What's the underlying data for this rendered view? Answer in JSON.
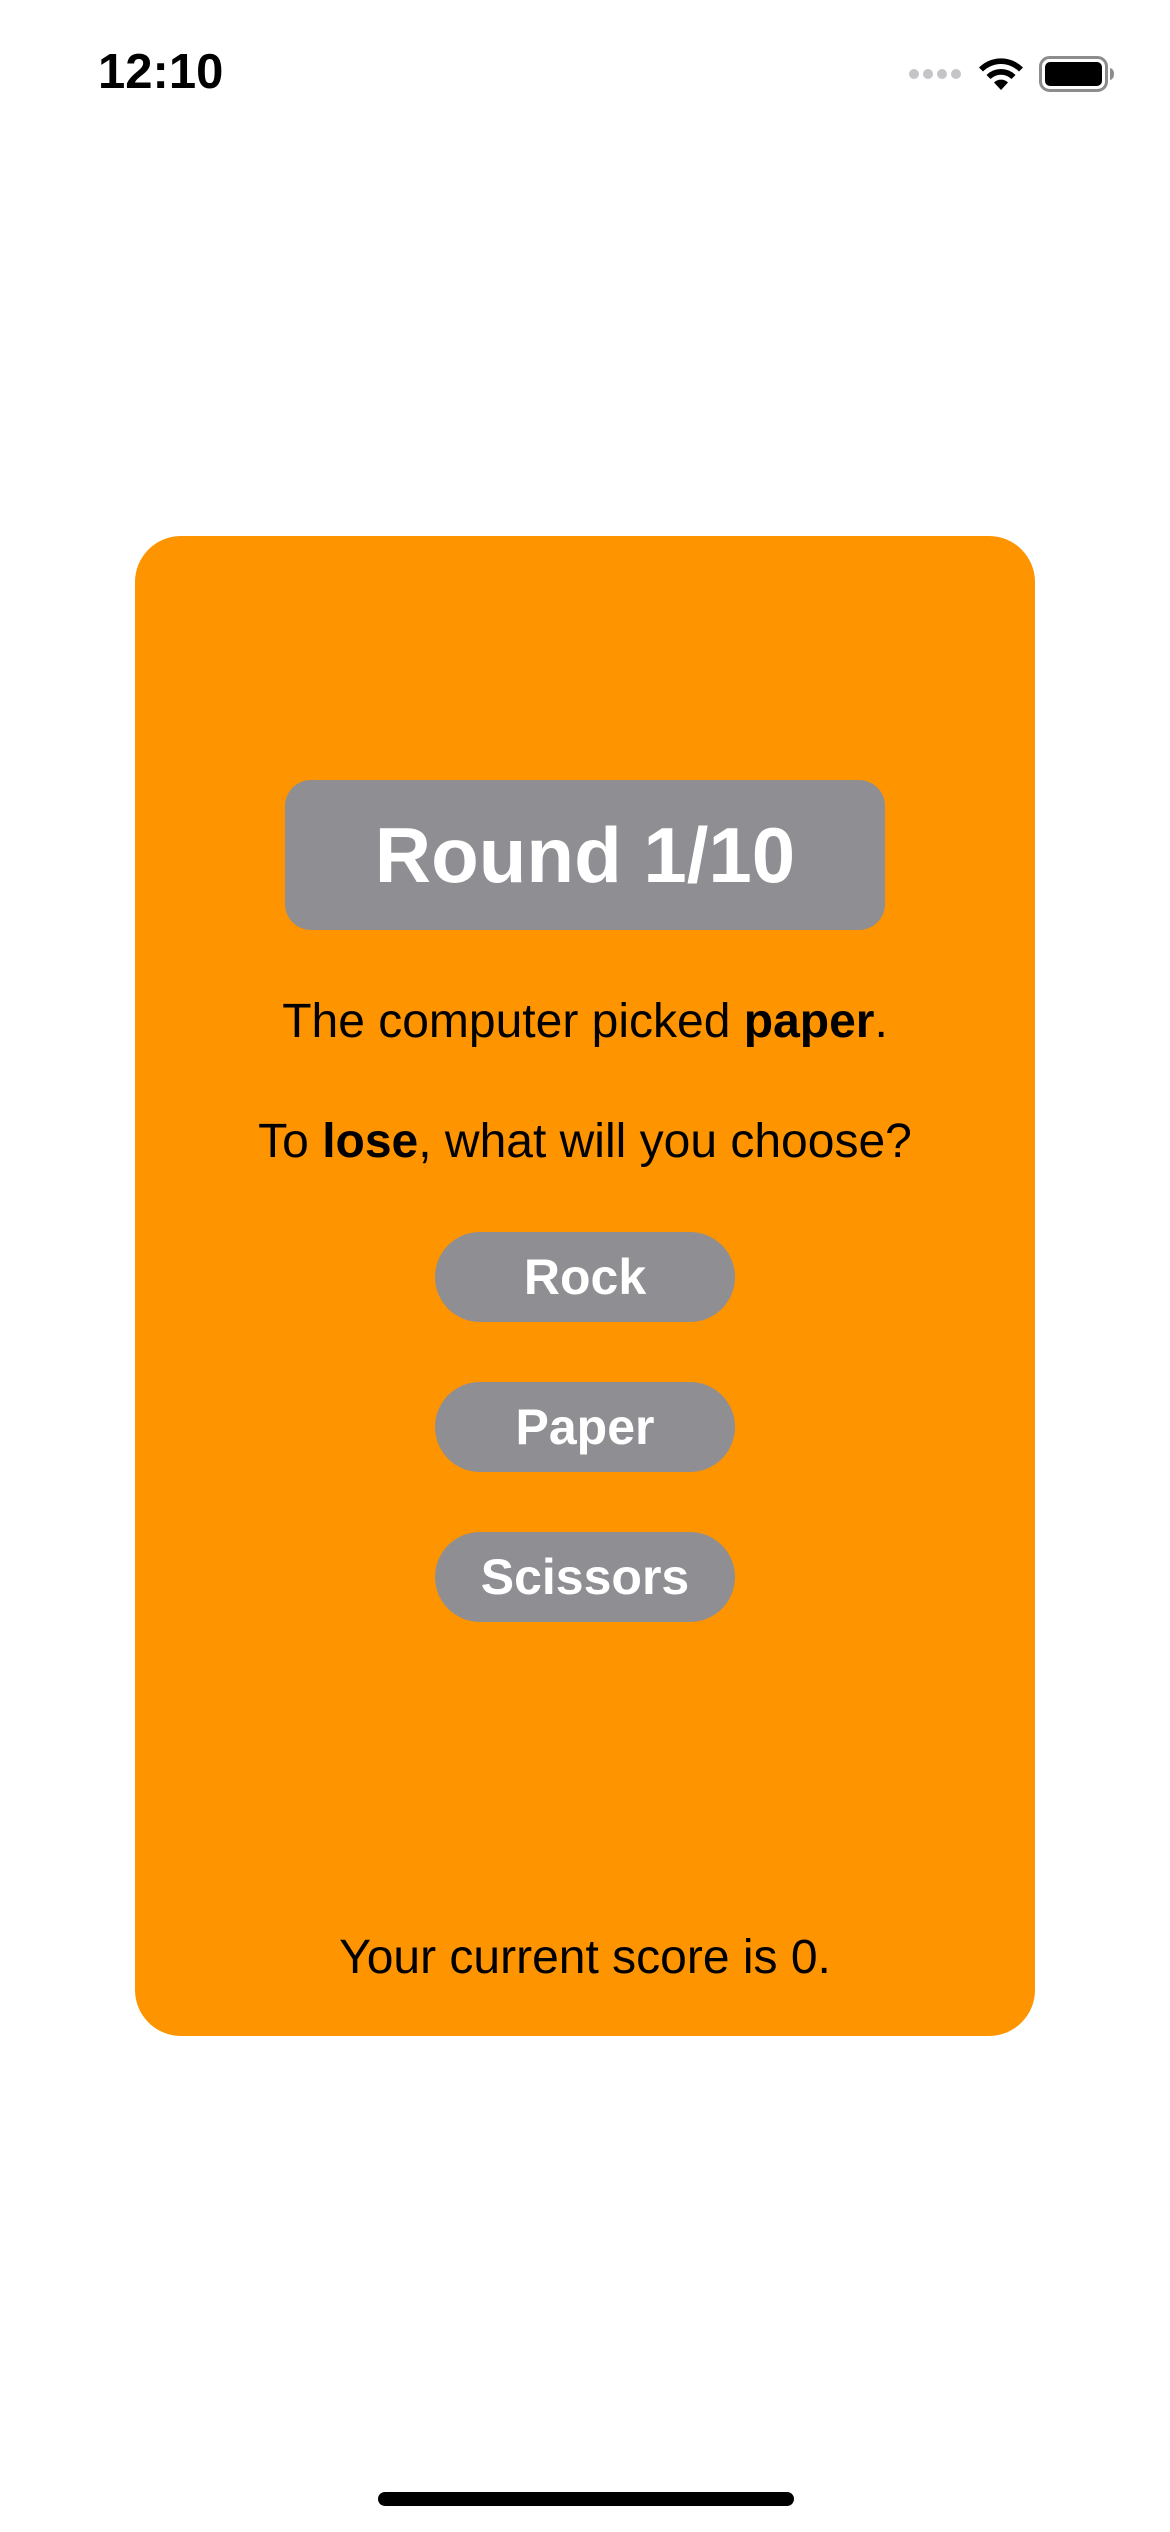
{
  "status_bar": {
    "time": "12:10",
    "icons": [
      "cellular-signal-icon",
      "wifi-icon",
      "battery-icon"
    ]
  },
  "colors": {
    "card_background": "#fd9400",
    "badge_background": "#8f8e93",
    "button_background": "#8f8e93",
    "button_text": "#ffffff",
    "body_text": "#000000",
    "page_background": "#ffffff"
  },
  "game": {
    "round_label": "Round 1/10",
    "computer_pick_prefix": "The computer picked ",
    "computer_pick": "paper",
    "computer_pick_suffix": ".",
    "goal_prefix": "To ",
    "goal": "lose",
    "goal_suffix": ", what will you choose?",
    "choices": {
      "rock": "Rock",
      "paper": "Paper",
      "scissors": "Scissors"
    },
    "score_text": "Your current score is 0."
  }
}
